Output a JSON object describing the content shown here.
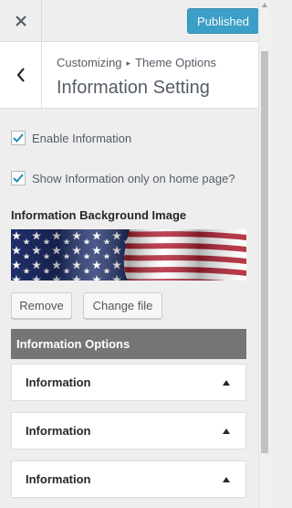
{
  "topbar": {
    "publish_label": "Published"
  },
  "header": {
    "breadcrumb_root": "Customizing",
    "breadcrumb_separator": "▸",
    "breadcrumb_panel": "Theme Options",
    "title": "Information Setting"
  },
  "controls": {
    "enable_label": "Enable Information",
    "enable_checked": true,
    "home_only_label": "Show Information only on home page?",
    "home_only_checked": true,
    "bg_image_label": "Information Background Image",
    "bg_image_icon": "us-flag-image",
    "remove_label": "Remove",
    "change_label": "Change file"
  },
  "options_group": {
    "title": "Information Options",
    "items": [
      {
        "label": "Information"
      },
      {
        "label": "Information"
      },
      {
        "label": "Information"
      }
    ]
  },
  "colors": {
    "accent": "#0085ba",
    "check": "#1e8cbe",
    "group_header": "#757575"
  }
}
